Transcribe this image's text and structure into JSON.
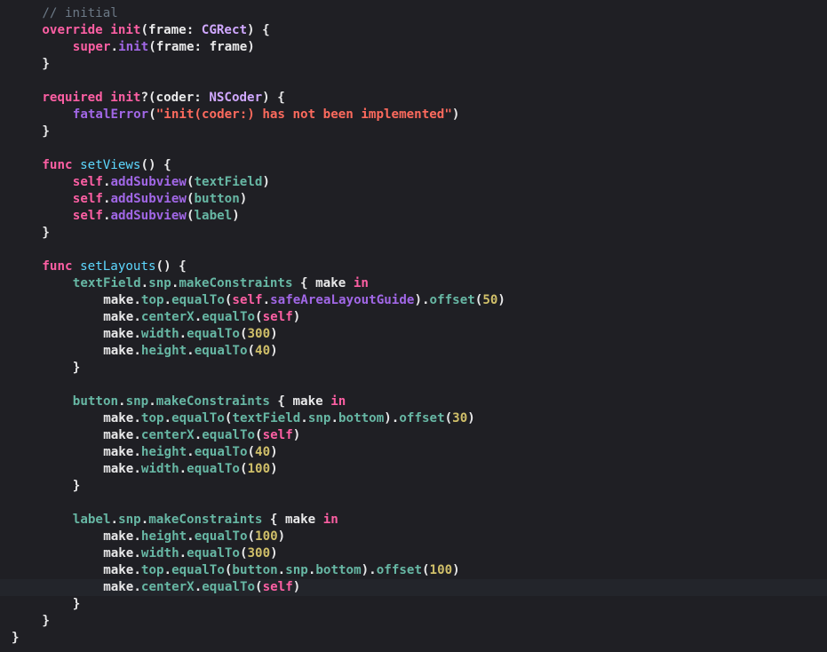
{
  "editor": {
    "theme": {
      "background": "#1f1f24",
      "current_line": "#23252b",
      "plain": "#e9e9ea",
      "keyword": "#fc5fa3",
      "comment": "#6c7986",
      "type": "#d0a8ff",
      "string": "#fc6a5d",
      "number": "#d0bf69",
      "method": "#a167e6",
      "project": "#67b7a4",
      "declaration": "#5dd8ff"
    },
    "current_line_index": 34,
    "lines": [
      {
        "indent": 1,
        "tokens": [
          {
            "t": "comment",
            "v": "// initial"
          }
        ]
      },
      {
        "indent": 1,
        "tokens": [
          {
            "t": "keyword",
            "v": "override"
          },
          {
            "t": "plain",
            "v": " "
          },
          {
            "t": "keyword",
            "v": "init"
          },
          {
            "t": "plain",
            "v": "(frame: "
          },
          {
            "t": "type",
            "v": "CGRect"
          },
          {
            "t": "plain",
            "v": ") {"
          }
        ]
      },
      {
        "indent": 2,
        "tokens": [
          {
            "t": "keyword",
            "v": "super"
          },
          {
            "t": "plain",
            "v": "."
          },
          {
            "t": "method",
            "v": "init"
          },
          {
            "t": "plain",
            "v": "(frame: frame)"
          }
        ]
      },
      {
        "indent": 1,
        "tokens": [
          {
            "t": "plain",
            "v": "}"
          }
        ]
      },
      {
        "indent": 0,
        "tokens": []
      },
      {
        "indent": 1,
        "tokens": [
          {
            "t": "keyword",
            "v": "required"
          },
          {
            "t": "plain",
            "v": " "
          },
          {
            "t": "keyword",
            "v": "init"
          },
          {
            "t": "plain",
            "v": "?(coder: "
          },
          {
            "t": "type",
            "v": "NSCoder"
          },
          {
            "t": "plain",
            "v": ") {"
          }
        ]
      },
      {
        "indent": 2,
        "tokens": [
          {
            "t": "method",
            "v": "fatalError"
          },
          {
            "t": "plain",
            "v": "("
          },
          {
            "t": "string",
            "v": "\"init(coder:) has not been implemented\""
          },
          {
            "t": "plain",
            "v": ")"
          }
        ]
      },
      {
        "indent": 1,
        "tokens": [
          {
            "t": "plain",
            "v": "}"
          }
        ]
      },
      {
        "indent": 0,
        "tokens": []
      },
      {
        "indent": 1,
        "tokens": [
          {
            "t": "keyword",
            "v": "func"
          },
          {
            "t": "plain",
            "v": " "
          },
          {
            "t": "declaration",
            "v": "setViews"
          },
          {
            "t": "plain",
            "v": "() {"
          }
        ]
      },
      {
        "indent": 2,
        "tokens": [
          {
            "t": "keyword",
            "v": "self"
          },
          {
            "t": "plain",
            "v": "."
          },
          {
            "t": "method",
            "v": "addSubview"
          },
          {
            "t": "plain",
            "v": "("
          },
          {
            "t": "project",
            "v": "textField"
          },
          {
            "t": "plain",
            "v": ")"
          }
        ]
      },
      {
        "indent": 2,
        "tokens": [
          {
            "t": "keyword",
            "v": "self"
          },
          {
            "t": "plain",
            "v": "."
          },
          {
            "t": "method",
            "v": "addSubview"
          },
          {
            "t": "plain",
            "v": "("
          },
          {
            "t": "project",
            "v": "button"
          },
          {
            "t": "plain",
            "v": ")"
          }
        ]
      },
      {
        "indent": 2,
        "tokens": [
          {
            "t": "keyword",
            "v": "self"
          },
          {
            "t": "plain",
            "v": "."
          },
          {
            "t": "method",
            "v": "addSubview"
          },
          {
            "t": "plain",
            "v": "("
          },
          {
            "t": "project",
            "v": "label"
          },
          {
            "t": "plain",
            "v": ")"
          }
        ]
      },
      {
        "indent": 1,
        "tokens": [
          {
            "t": "plain",
            "v": "}"
          }
        ]
      },
      {
        "indent": 0,
        "tokens": []
      },
      {
        "indent": 1,
        "tokens": [
          {
            "t": "keyword",
            "v": "func"
          },
          {
            "t": "plain",
            "v": " "
          },
          {
            "t": "declaration",
            "v": "setLayouts"
          },
          {
            "t": "plain",
            "v": "() {"
          }
        ]
      },
      {
        "indent": 2,
        "tokens": [
          {
            "t": "project",
            "v": "textField"
          },
          {
            "t": "plain",
            "v": "."
          },
          {
            "t": "project",
            "v": "snp"
          },
          {
            "t": "plain",
            "v": "."
          },
          {
            "t": "project",
            "v": "makeConstraints"
          },
          {
            "t": "plain",
            "v": " { make "
          },
          {
            "t": "keyword",
            "v": "in"
          }
        ]
      },
      {
        "indent": 3,
        "tokens": [
          {
            "t": "plain",
            "v": "make."
          },
          {
            "t": "project",
            "v": "top"
          },
          {
            "t": "plain",
            "v": "."
          },
          {
            "t": "project",
            "v": "equalTo"
          },
          {
            "t": "plain",
            "v": "("
          },
          {
            "t": "keyword",
            "v": "self"
          },
          {
            "t": "plain",
            "v": "."
          },
          {
            "t": "method",
            "v": "safeAreaLayoutGuide"
          },
          {
            "t": "plain",
            "v": ")."
          },
          {
            "t": "project",
            "v": "offset"
          },
          {
            "t": "plain",
            "v": "("
          },
          {
            "t": "number",
            "v": "50"
          },
          {
            "t": "plain",
            "v": ")"
          }
        ]
      },
      {
        "indent": 3,
        "tokens": [
          {
            "t": "plain",
            "v": "make."
          },
          {
            "t": "project",
            "v": "centerX"
          },
          {
            "t": "plain",
            "v": "."
          },
          {
            "t": "project",
            "v": "equalTo"
          },
          {
            "t": "plain",
            "v": "("
          },
          {
            "t": "keyword",
            "v": "self"
          },
          {
            "t": "plain",
            "v": ")"
          }
        ]
      },
      {
        "indent": 3,
        "tokens": [
          {
            "t": "plain",
            "v": "make."
          },
          {
            "t": "project",
            "v": "width"
          },
          {
            "t": "plain",
            "v": "."
          },
          {
            "t": "project",
            "v": "equalTo"
          },
          {
            "t": "plain",
            "v": "("
          },
          {
            "t": "number",
            "v": "300"
          },
          {
            "t": "plain",
            "v": ")"
          }
        ]
      },
      {
        "indent": 3,
        "tokens": [
          {
            "t": "plain",
            "v": "make."
          },
          {
            "t": "project",
            "v": "height"
          },
          {
            "t": "plain",
            "v": "."
          },
          {
            "t": "project",
            "v": "equalTo"
          },
          {
            "t": "plain",
            "v": "("
          },
          {
            "t": "number",
            "v": "40"
          },
          {
            "t": "plain",
            "v": ")"
          }
        ]
      },
      {
        "indent": 2,
        "tokens": [
          {
            "t": "plain",
            "v": "}"
          }
        ]
      },
      {
        "indent": 0,
        "tokens": []
      },
      {
        "indent": 2,
        "tokens": [
          {
            "t": "project",
            "v": "button"
          },
          {
            "t": "plain",
            "v": "."
          },
          {
            "t": "project",
            "v": "snp"
          },
          {
            "t": "plain",
            "v": "."
          },
          {
            "t": "project",
            "v": "makeConstraints"
          },
          {
            "t": "plain",
            "v": " { make "
          },
          {
            "t": "keyword",
            "v": "in"
          }
        ]
      },
      {
        "indent": 3,
        "tokens": [
          {
            "t": "plain",
            "v": "make."
          },
          {
            "t": "project",
            "v": "top"
          },
          {
            "t": "plain",
            "v": "."
          },
          {
            "t": "project",
            "v": "equalTo"
          },
          {
            "t": "plain",
            "v": "("
          },
          {
            "t": "project",
            "v": "textField"
          },
          {
            "t": "plain",
            "v": "."
          },
          {
            "t": "project",
            "v": "snp"
          },
          {
            "t": "plain",
            "v": "."
          },
          {
            "t": "project",
            "v": "bottom"
          },
          {
            "t": "plain",
            "v": ")."
          },
          {
            "t": "project",
            "v": "offset"
          },
          {
            "t": "plain",
            "v": "("
          },
          {
            "t": "number",
            "v": "30"
          },
          {
            "t": "plain",
            "v": ")"
          }
        ]
      },
      {
        "indent": 3,
        "tokens": [
          {
            "t": "plain",
            "v": "make."
          },
          {
            "t": "project",
            "v": "centerX"
          },
          {
            "t": "plain",
            "v": "."
          },
          {
            "t": "project",
            "v": "equalTo"
          },
          {
            "t": "plain",
            "v": "("
          },
          {
            "t": "keyword",
            "v": "self"
          },
          {
            "t": "plain",
            "v": ")"
          }
        ]
      },
      {
        "indent": 3,
        "tokens": [
          {
            "t": "plain",
            "v": "make."
          },
          {
            "t": "project",
            "v": "height"
          },
          {
            "t": "plain",
            "v": "."
          },
          {
            "t": "project",
            "v": "equalTo"
          },
          {
            "t": "plain",
            "v": "("
          },
          {
            "t": "number",
            "v": "40"
          },
          {
            "t": "plain",
            "v": ")"
          }
        ]
      },
      {
        "indent": 3,
        "tokens": [
          {
            "t": "plain",
            "v": "make."
          },
          {
            "t": "project",
            "v": "width"
          },
          {
            "t": "plain",
            "v": "."
          },
          {
            "t": "project",
            "v": "equalTo"
          },
          {
            "t": "plain",
            "v": "("
          },
          {
            "t": "number",
            "v": "100"
          },
          {
            "t": "plain",
            "v": ")"
          }
        ]
      },
      {
        "indent": 2,
        "tokens": [
          {
            "t": "plain",
            "v": "}"
          }
        ]
      },
      {
        "indent": 0,
        "tokens": []
      },
      {
        "indent": 2,
        "tokens": [
          {
            "t": "project",
            "v": "label"
          },
          {
            "t": "plain",
            "v": "."
          },
          {
            "t": "project",
            "v": "snp"
          },
          {
            "t": "plain",
            "v": "."
          },
          {
            "t": "project",
            "v": "makeConstraints"
          },
          {
            "t": "plain",
            "v": " { make "
          },
          {
            "t": "keyword",
            "v": "in"
          }
        ]
      },
      {
        "indent": 3,
        "tokens": [
          {
            "t": "plain",
            "v": "make."
          },
          {
            "t": "project",
            "v": "height"
          },
          {
            "t": "plain",
            "v": "."
          },
          {
            "t": "project",
            "v": "equalTo"
          },
          {
            "t": "plain",
            "v": "("
          },
          {
            "t": "number",
            "v": "100"
          },
          {
            "t": "plain",
            "v": ")"
          }
        ]
      },
      {
        "indent": 3,
        "tokens": [
          {
            "t": "plain",
            "v": "make."
          },
          {
            "t": "project",
            "v": "width"
          },
          {
            "t": "plain",
            "v": "."
          },
          {
            "t": "project",
            "v": "equalTo"
          },
          {
            "t": "plain",
            "v": "("
          },
          {
            "t": "number",
            "v": "300"
          },
          {
            "t": "plain",
            "v": ")"
          }
        ]
      },
      {
        "indent": 3,
        "tokens": [
          {
            "t": "plain",
            "v": "make."
          },
          {
            "t": "project",
            "v": "top"
          },
          {
            "t": "plain",
            "v": "."
          },
          {
            "t": "project",
            "v": "equalTo"
          },
          {
            "t": "plain",
            "v": "("
          },
          {
            "t": "project",
            "v": "button"
          },
          {
            "t": "plain",
            "v": "."
          },
          {
            "t": "project",
            "v": "snp"
          },
          {
            "t": "plain",
            "v": "."
          },
          {
            "t": "project",
            "v": "bottom"
          },
          {
            "t": "plain",
            "v": ")."
          },
          {
            "t": "project",
            "v": "offset"
          },
          {
            "t": "plain",
            "v": "("
          },
          {
            "t": "number",
            "v": "100"
          },
          {
            "t": "plain",
            "v": ")"
          }
        ]
      },
      {
        "indent": 3,
        "tokens": [
          {
            "t": "plain",
            "v": "make."
          },
          {
            "t": "project",
            "v": "centerX"
          },
          {
            "t": "plain",
            "v": "."
          },
          {
            "t": "project",
            "v": "equalTo"
          },
          {
            "t": "plain",
            "v": "("
          },
          {
            "t": "keyword",
            "v": "self"
          },
          {
            "t": "plain",
            "v": ")"
          }
        ]
      },
      {
        "indent": 2,
        "tokens": [
          {
            "t": "plain",
            "v": "}"
          }
        ]
      },
      {
        "indent": 1,
        "tokens": [
          {
            "t": "plain",
            "v": "}"
          }
        ]
      },
      {
        "indent": 0,
        "tokens": [
          {
            "t": "plain",
            "v": "}"
          }
        ]
      }
    ]
  }
}
